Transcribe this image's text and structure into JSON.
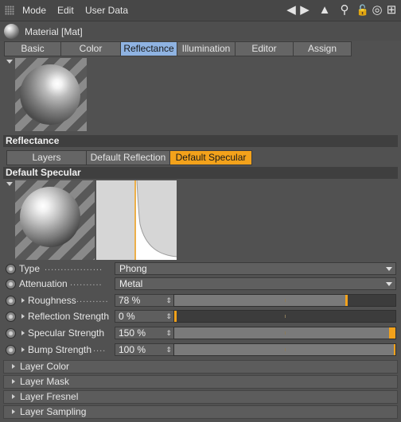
{
  "menu": {
    "items": [
      "Mode",
      "Edit",
      "User Data"
    ]
  },
  "toolbar": {
    "icons": [
      "arrow-left-icon",
      "arrow-right-icon",
      "cursor-icon",
      "search-icon",
      "lock-icon",
      "target-icon",
      "add-icon"
    ],
    "back_glyph": "◀",
    "forward_glyph": "▶",
    "cursor_glyph": "▲",
    "search_glyph": "⚲",
    "lock_glyph": "🔓",
    "target_glyph": "◎",
    "add_glyph": "⊞"
  },
  "material": {
    "title": "Material [Mat]"
  },
  "tabs": [
    {
      "label": "Basic",
      "active": false
    },
    {
      "label": "Color",
      "active": false
    },
    {
      "label": "Reflectance",
      "active": true
    },
    {
      "label": "Illumination",
      "active": false
    },
    {
      "label": "Editor",
      "active": false
    },
    {
      "label": "Assign",
      "active": false
    }
  ],
  "reflectance": {
    "header": "Reflectance",
    "layer_tabs": [
      {
        "label": "Layers",
        "active": false
      },
      {
        "label": "Default Reflection",
        "active": false
      },
      {
        "label": "Default Specular",
        "active": true
      }
    ]
  },
  "specular": {
    "header": "Default Specular",
    "params": [
      {
        "label": "Type",
        "dots": "..................",
        "value": "Phong",
        "kind": "dropdown"
      },
      {
        "label": "Attenuation",
        "dots": "..........",
        "value": "Metal",
        "kind": "dropdown"
      },
      {
        "label": "Roughness",
        "dots": "..........",
        "value": "78 %",
        "kind": "slider",
        "level": 0.78
      },
      {
        "label": "Reflection Strength",
        "dots": "",
        "value": "0 %",
        "kind": "slider",
        "level": 0.0
      },
      {
        "label": "Specular Strength",
        "dots": "",
        "value": "150 %",
        "kind": "slider",
        "level": 1.0
      },
      {
        "label": "Bump Strength",
        "dots": "....",
        "value": "100 %",
        "kind": "slider",
        "level": 1.0
      }
    ]
  },
  "groups": [
    {
      "label": "Layer Color"
    },
    {
      "label": "Layer Mask"
    },
    {
      "label": "Layer Fresnel"
    },
    {
      "label": "Layer Sampling"
    }
  ],
  "colors": {
    "accent": "#f3a21b",
    "active_tab_blue": "#8fb3e2",
    "panel": "#515151"
  }
}
